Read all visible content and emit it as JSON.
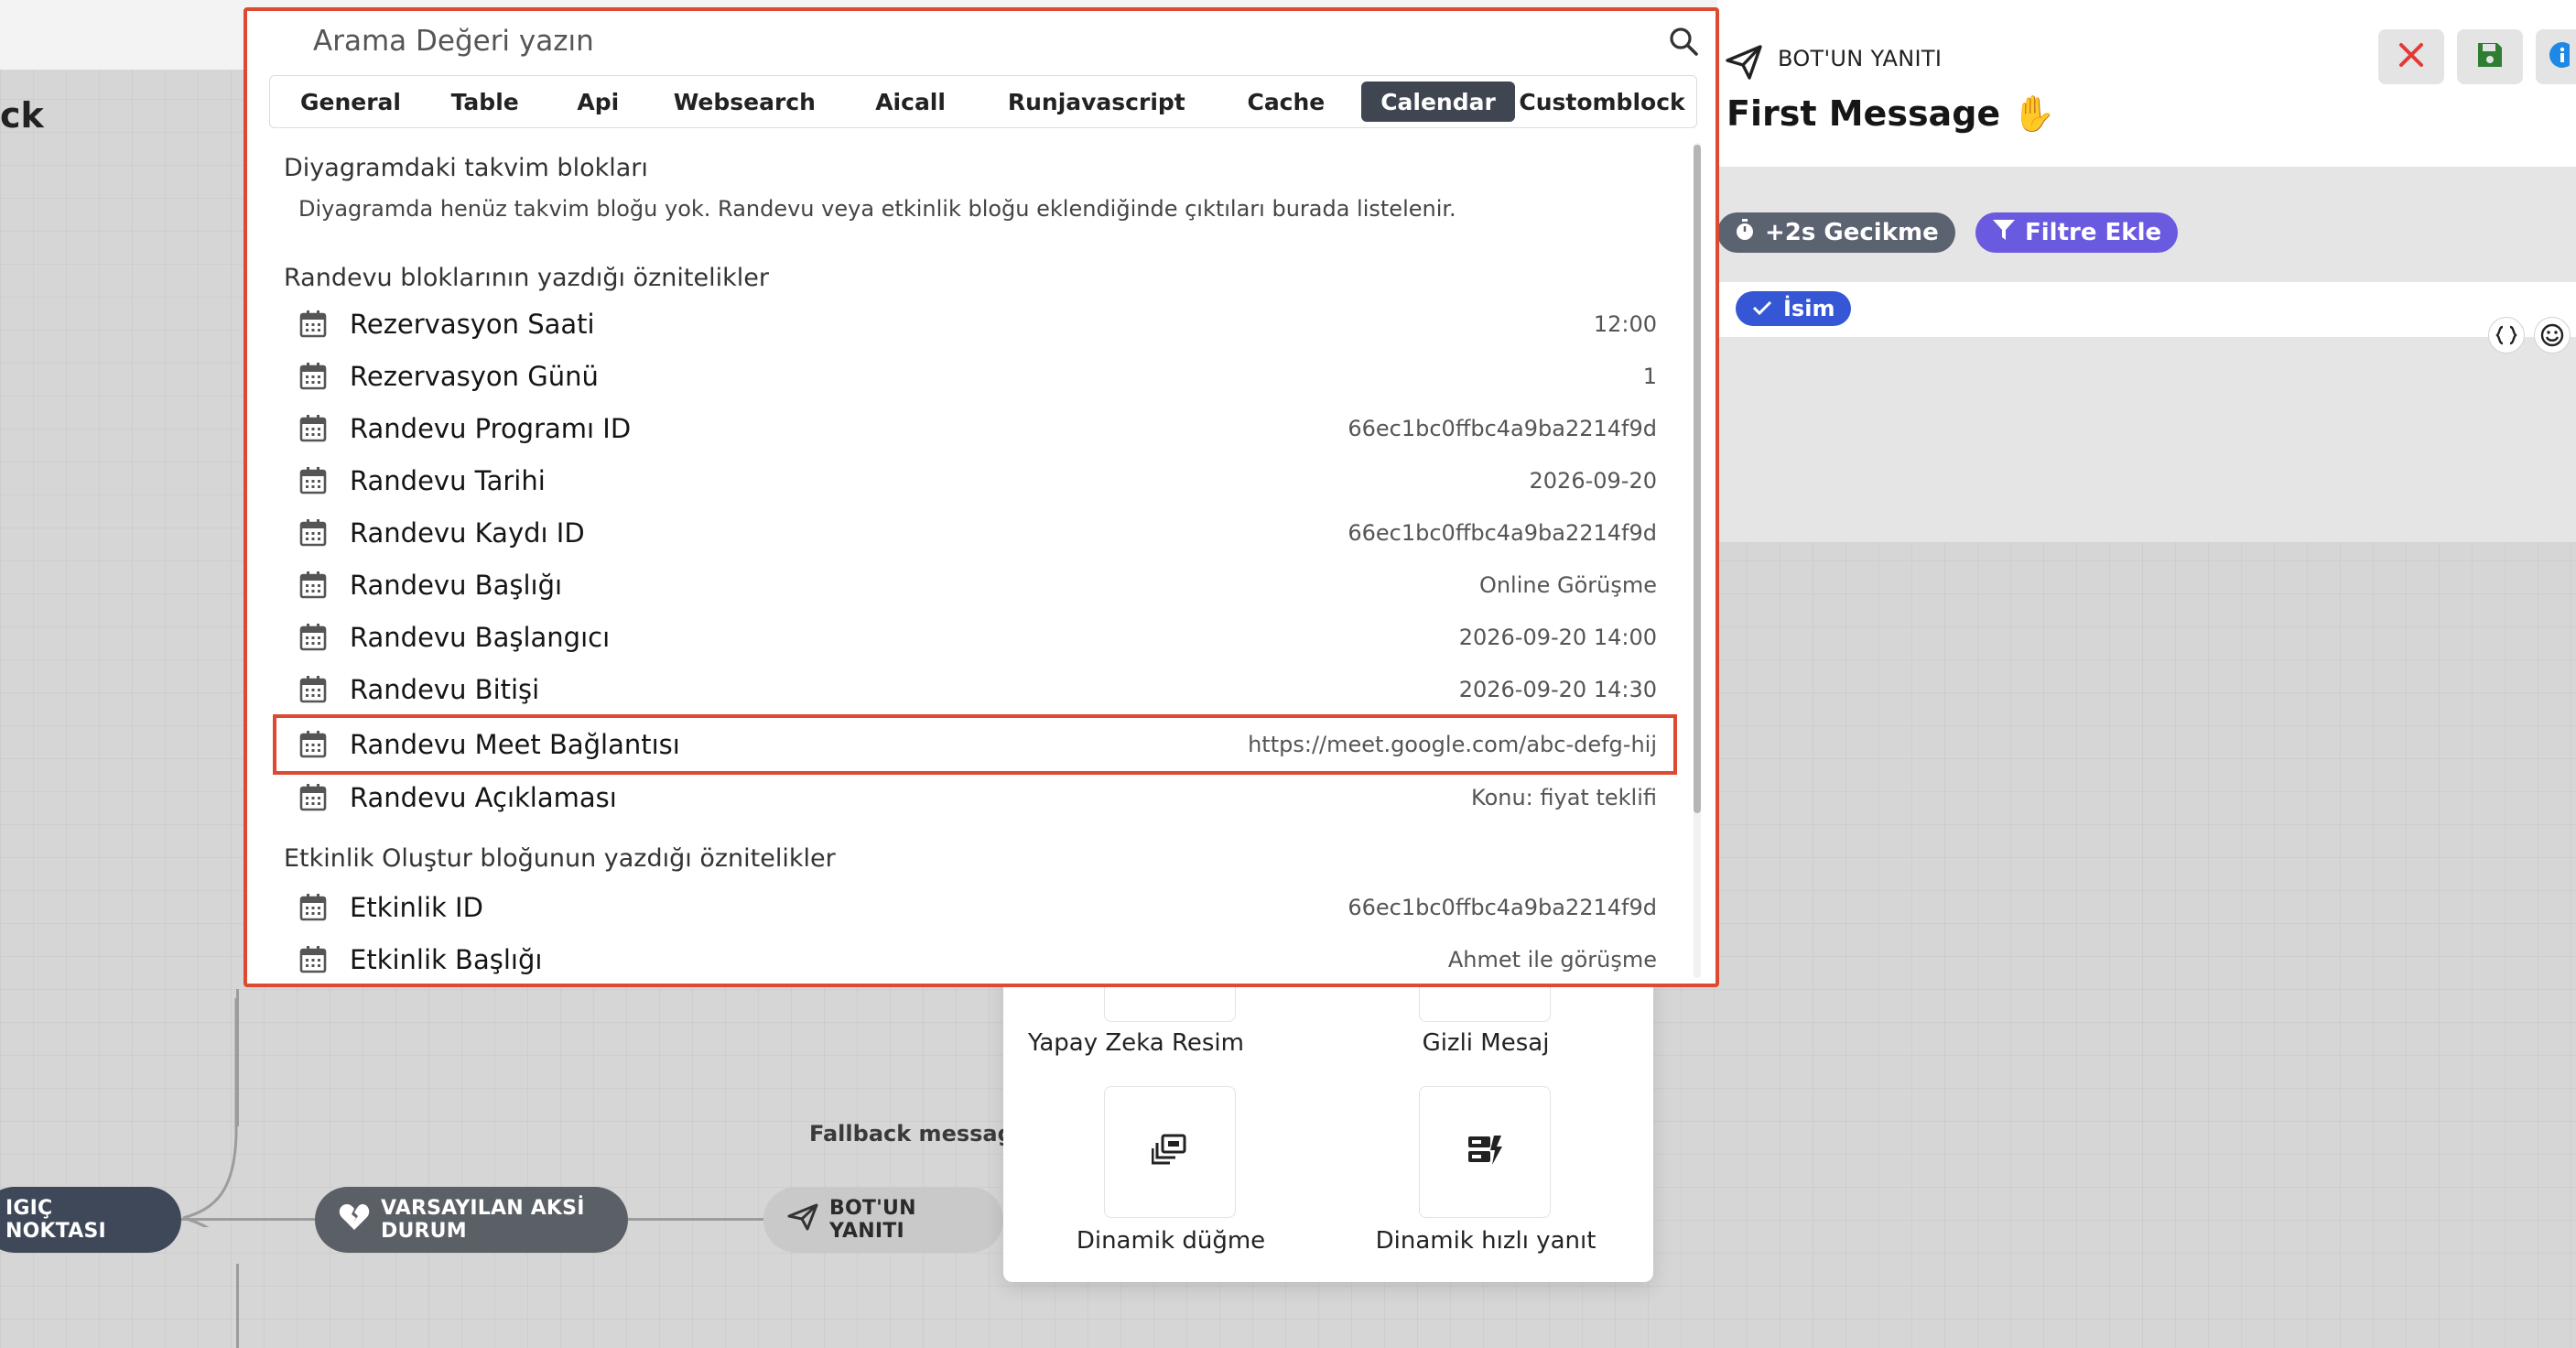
{
  "canvas": {
    "title_fragment": "ck",
    "nodes": {
      "start": "IGIÇ NOKTASI",
      "default_fallback": "VARSAYILAN AKSİ DURUM",
      "bot_reply": "BOT'UN YANITI"
    },
    "fallback_label": "Fallback messag"
  },
  "block_picker": {
    "tiles": [
      {
        "label": "Yapay Zeka Resim",
        "icon": "image-ai-icon"
      },
      {
        "label": "Gizli Mesaj",
        "icon": "hidden-message-icon"
      },
      {
        "label": "Dinamik düğme",
        "icon": "dynamic-button-icon"
      },
      {
        "label": "Dinamik hızlı yanıt",
        "icon": "dynamic-quick-reply-icon"
      }
    ]
  },
  "right_panel": {
    "type_label": "BOT'UN YANITI",
    "title": "First Message ✋",
    "delay_chip": "+2s Gecikme",
    "filter_chip": "Filtre Ekle",
    "variable_chip": "İsim",
    "colors": {
      "close": "#e53935",
      "save": "#2e7d32",
      "info": "#1e88e5",
      "filter": "#6a5ae0",
      "delay": "#5b6270"
    }
  },
  "popup": {
    "search": {
      "placeholder": "Arama Değeri yazın"
    },
    "tabs": [
      {
        "label": "General"
      },
      {
        "label": "Table"
      },
      {
        "label": "Api"
      },
      {
        "label": "Websearch"
      },
      {
        "label": "Aicall"
      },
      {
        "label": "Runjavascript"
      },
      {
        "label": "Cache"
      },
      {
        "label": "Calendar"
      },
      {
        "label": "Customblock"
      }
    ],
    "active_tab": "Calendar",
    "sections": {
      "calendar_blocks": {
        "title": "Diyagramdaki takvim blokları",
        "note": "Diyagramda henüz takvim bloğu yok. Randevu veya etkinlik bloğu eklendiğinde çıktıları burada listelenir."
      },
      "appointment": {
        "title": "Randevu bloklarının yazdığı öznitelikler",
        "items": [
          {
            "label": "Rezervasyon Saati",
            "value": "12:00"
          },
          {
            "label": "Rezervasyon Günü",
            "value": "1"
          },
          {
            "label": "Randevu Programı ID",
            "value": "66ec1bc0ffbc4a9ba2214f9d"
          },
          {
            "label": "Randevu Tarihi",
            "value": "2026-09-20"
          },
          {
            "label": "Randevu Kaydı ID",
            "value": "66ec1bc0ffbc4a9ba2214f9d"
          },
          {
            "label": "Randevu Başlığı",
            "value": "Online Görüşme"
          },
          {
            "label": "Randevu Başlangıcı",
            "value": "2026-09-20 14:00"
          },
          {
            "label": "Randevu Bitişi",
            "value": "2026-09-20 14:30"
          },
          {
            "label": "Randevu Meet Bağlantısı",
            "value": "https://meet.google.com/abc-defg-hij"
          },
          {
            "label": "Randevu Açıklaması",
            "value": "Konu: fiyat teklifi"
          }
        ]
      },
      "event": {
        "title": "Etkinlik Oluştur bloğunun yazdığı öznitelikler",
        "items": [
          {
            "label": "Etkinlik ID",
            "value": "66ec1bc0ffbc4a9ba2214f9d"
          },
          {
            "label": "Etkinlik Başlığı",
            "value": "Ahmet ile görüşme"
          }
        ]
      }
    },
    "highlight_color": "#dc4a31"
  }
}
